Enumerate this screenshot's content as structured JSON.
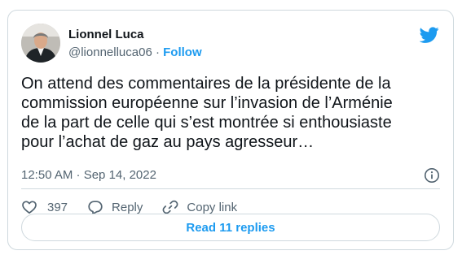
{
  "author": {
    "name": "Lionnel Luca",
    "handle": "@lionnelluca06",
    "separator": "·",
    "follow_label": "Follow",
    "avatar_icon": "user-photo"
  },
  "brand": {
    "icon": "twitter-bird-icon",
    "color": "#1d9bf0"
  },
  "tweet": {
    "text": "On attend des commentaires de la présidente de la\ncommission européenne sur l’invasion de l’Arménie\nde la part de celle qui s’est montrée si enthousiaste\npour l’achat de gaz au pays agresseur…",
    "timestamp": "12:50 AM · Sep 14, 2022"
  },
  "actions": {
    "like_count": "397",
    "reply_label": "Reply",
    "copy_link_label": "Copy link"
  },
  "read_replies_label": "Read 11 replies"
}
